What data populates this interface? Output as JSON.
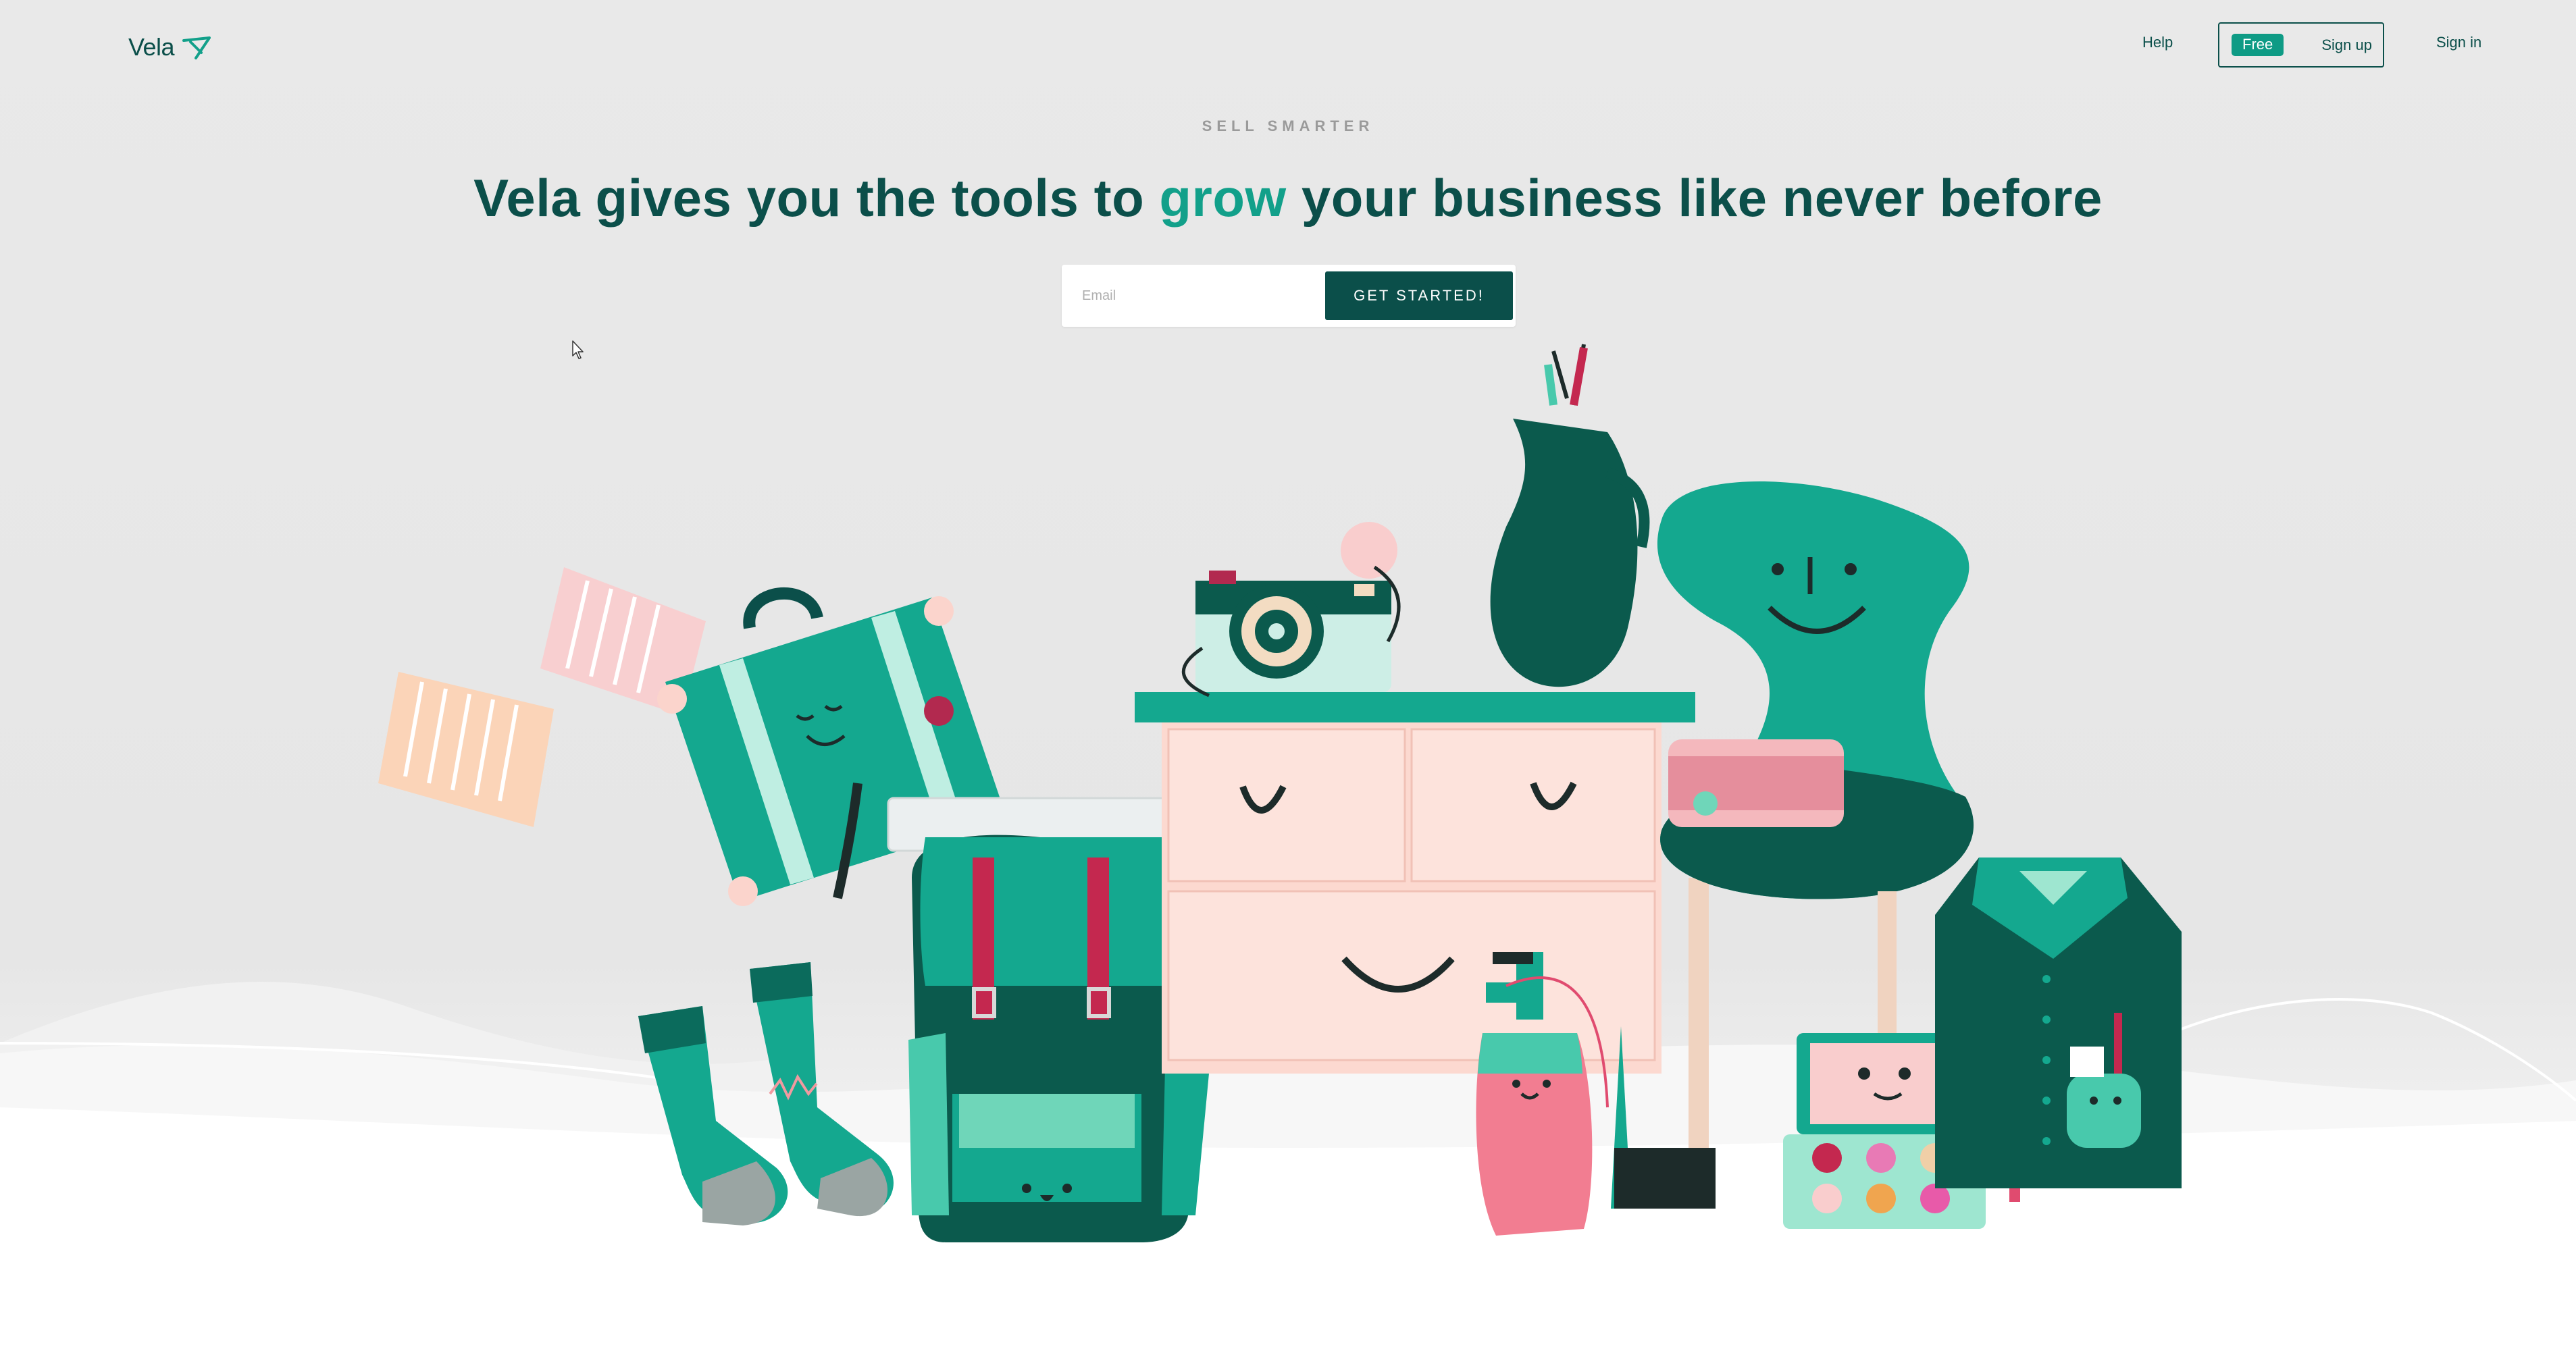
{
  "nav": {
    "logo_text": "Vela",
    "help": "Help",
    "free_badge": "Free",
    "signup": "Sign up",
    "signin": "Sign in"
  },
  "hero": {
    "eyebrow": "SELL SMARTER",
    "headline_before": "Vela gives you the tools to ",
    "headline_accent": "grow",
    "headline_after": " your business like never before",
    "email_placeholder": "Email",
    "cta": "GET STARTED!"
  },
  "colors": {
    "brand_dark": "#0b4f4a",
    "brand_teal": "#12a08a",
    "badge_teal": "#0e9b85",
    "illustration_teal": "#14a88f",
    "illustration_pink": "#fcd9d0"
  },
  "icons": {
    "logo": "vela-logo-icon",
    "cursor": "mouse-pointer-icon"
  }
}
